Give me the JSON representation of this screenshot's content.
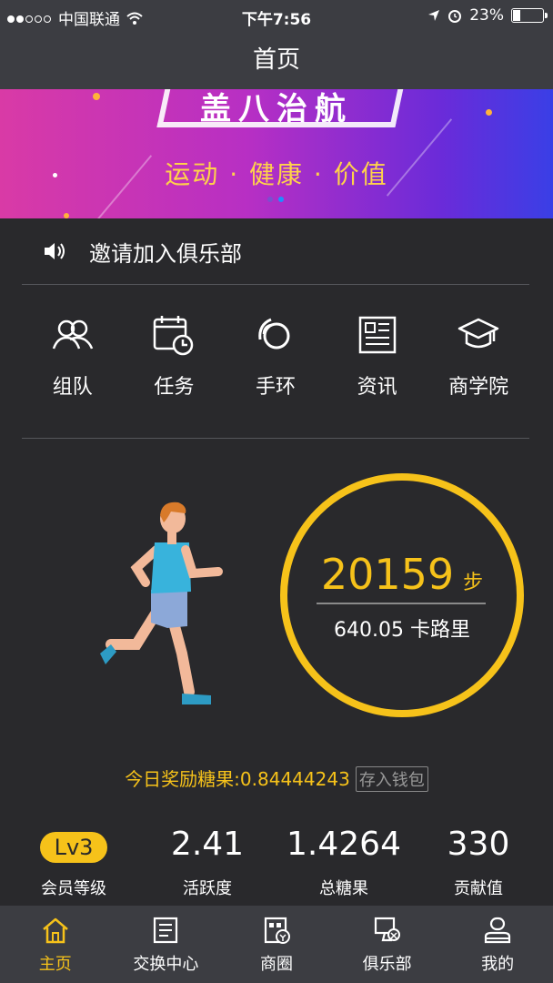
{
  "status_bar": {
    "carrier": "中国联通",
    "time": "下午7:56",
    "battery": "23%"
  },
  "nav": {
    "title": "首页"
  },
  "banner": {
    "title": "盖八治航",
    "subtitle": "运动 · 健康 · 价值",
    "page_count": 2,
    "active_page": 2
  },
  "notice": {
    "text": "邀请加入俱乐部"
  },
  "menu": {
    "items": [
      {
        "label": "组队",
        "icon": "team-icon"
      },
      {
        "label": "任务",
        "icon": "task-calendar-icon"
      },
      {
        "label": "手环",
        "icon": "wristband-icon"
      },
      {
        "label": "资讯",
        "icon": "news-icon"
      },
      {
        "label": "商学院",
        "icon": "graduation-cap-icon"
      }
    ]
  },
  "activity": {
    "steps": "20159",
    "steps_unit": "步",
    "calories": "640.05 卡路里"
  },
  "reward": {
    "text": "今日奖励糖果:0.84444243",
    "save_button": "存入钱包"
  },
  "stats": {
    "level": {
      "value": "Lv3",
      "label": "会员等级"
    },
    "activity": {
      "value": "2.41",
      "label": "活跃度"
    },
    "candy": {
      "value": "1.4264",
      "label": "总糖果"
    },
    "contribution": {
      "value": "330",
      "label": "贡献值"
    }
  },
  "tabs": [
    {
      "label": "主页",
      "icon": "home-icon",
      "active": true
    },
    {
      "label": "交换中心",
      "icon": "exchange-icon",
      "active": false
    },
    {
      "label": "商圈",
      "icon": "shop-icon",
      "active": false
    },
    {
      "label": "俱乐部",
      "icon": "club-icon",
      "active": false
    },
    {
      "label": "我的",
      "icon": "profile-icon",
      "active": false
    }
  ],
  "colors": {
    "background": "#29292c",
    "bar": "#3c3d42",
    "accent": "#f6c21a"
  }
}
